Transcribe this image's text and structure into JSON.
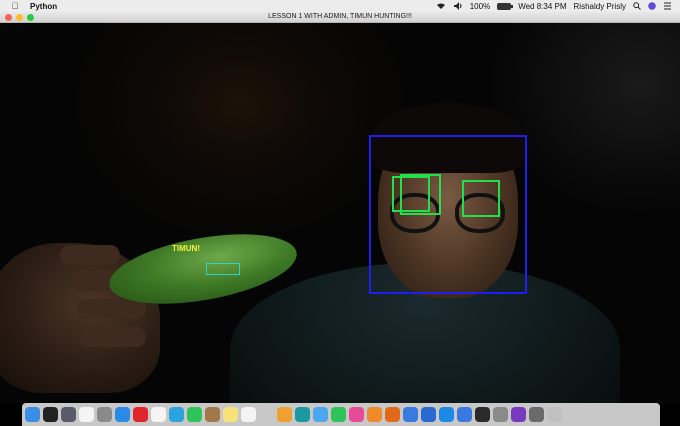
{
  "menubar": {
    "apple_icon": "apple-logo",
    "app_name": "Python",
    "battery_percent": "100%",
    "battery_level": 1.0,
    "clock": "Wed 8:34 PM",
    "user_name": "Rishaldy Prisly"
  },
  "window": {
    "title": "LESSON 1 WITH ADMIN, TIMUN HUNTING!!!"
  },
  "detection": {
    "object_label": "TIMUN!"
  },
  "colors": {
    "face_box": "#1e1ef0",
    "eye_box": "#22e04a",
    "object_box": "#2ad4c8",
    "object_label": "#f2f23a"
  },
  "dock": {
    "icons": [
      {
        "name": "finder-icon",
        "color": "#3a8ee6"
      },
      {
        "name": "terminal-icon",
        "color": "#222222"
      },
      {
        "name": "mission-control-icon",
        "color": "#5a5a6a"
      },
      {
        "name": "calendar-icon",
        "color": "#f4f4f4"
      },
      {
        "name": "launchpad-icon",
        "color": "#8a8a8a"
      },
      {
        "name": "safari-icon",
        "color": "#2a8ae6"
      },
      {
        "name": "opera-icon",
        "color": "#e0252b"
      },
      {
        "name": "textedit-icon",
        "color": "#f4f4f4"
      },
      {
        "name": "telegram-icon",
        "color": "#2aa3de"
      },
      {
        "name": "whatsapp-icon",
        "color": "#2fc45a"
      },
      {
        "name": "notebook-icon",
        "color": "#a0784a"
      },
      {
        "name": "notes-icon",
        "color": "#f7e27a"
      },
      {
        "name": "reminders-icon",
        "color": "#f4f4f4"
      },
      {
        "name": "preview-icon",
        "color": "#c8c8c8"
      },
      {
        "name": "photos-icon",
        "color": "#f0a030"
      },
      {
        "name": "arduino-icon",
        "color": "#1a9aa0"
      },
      {
        "name": "messages-icon",
        "color": "#4aa8f0"
      },
      {
        "name": "facetime-icon",
        "color": "#2ec45a"
      },
      {
        "name": "itunes-icon",
        "color": "#e84a9a"
      },
      {
        "name": "books-icon",
        "color": "#f08a2a"
      },
      {
        "name": "ibooks-icon",
        "color": "#e06a1a"
      },
      {
        "name": "chrome-icon",
        "color": "#3a7ae0"
      },
      {
        "name": "xcode-icon",
        "color": "#2a6ad0"
      },
      {
        "name": "app-store-icon",
        "color": "#1a8ae6"
      },
      {
        "name": "keynote-icon",
        "color": "#3a7ae0"
      },
      {
        "name": "activity-monitor-icon",
        "color": "#2a2a2a"
      },
      {
        "name": "system-preferences-icon",
        "color": "#8a8a8a"
      },
      {
        "name": "imovie-icon",
        "color": "#7a3ac0"
      },
      {
        "name": "downloads-icon",
        "color": "#6a6a6a"
      },
      {
        "name": "trash-icon",
        "color": "#c0c0c0"
      }
    ]
  }
}
